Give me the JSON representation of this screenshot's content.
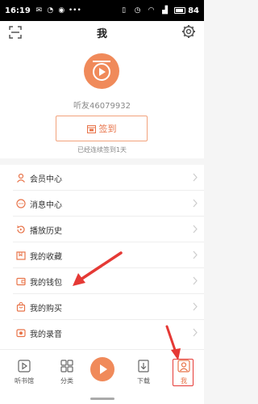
{
  "status_bar": {
    "time": "16:19",
    "battery": "84"
  },
  "header": {
    "title": "我"
  },
  "profile": {
    "username": "听友46079932",
    "signin_label": "签到",
    "streak": "已经连续签到1天"
  },
  "menu": {
    "items": [
      {
        "label": "会员中心",
        "icon": "vip-icon"
      },
      {
        "label": "消息中心",
        "icon": "message-icon"
      },
      {
        "label": "播放历史",
        "icon": "history-icon"
      },
      {
        "label": "我的收藏",
        "icon": "favorite-icon"
      },
      {
        "label": "我的钱包",
        "icon": "wallet-icon"
      },
      {
        "label": "我的购买",
        "icon": "purchase-icon"
      },
      {
        "label": "我的录音",
        "icon": "recording-icon"
      }
    ]
  },
  "tabbar": {
    "items": [
      {
        "label": "听书馆",
        "icon": "library-icon"
      },
      {
        "label": "分类",
        "icon": "grid-icon"
      },
      {
        "label": "下载",
        "icon": "download-icon"
      },
      {
        "label": "我",
        "icon": "person-icon",
        "active": true
      }
    ]
  },
  "colors": {
    "accent": "#e8744a",
    "annotation": "#e53935"
  }
}
